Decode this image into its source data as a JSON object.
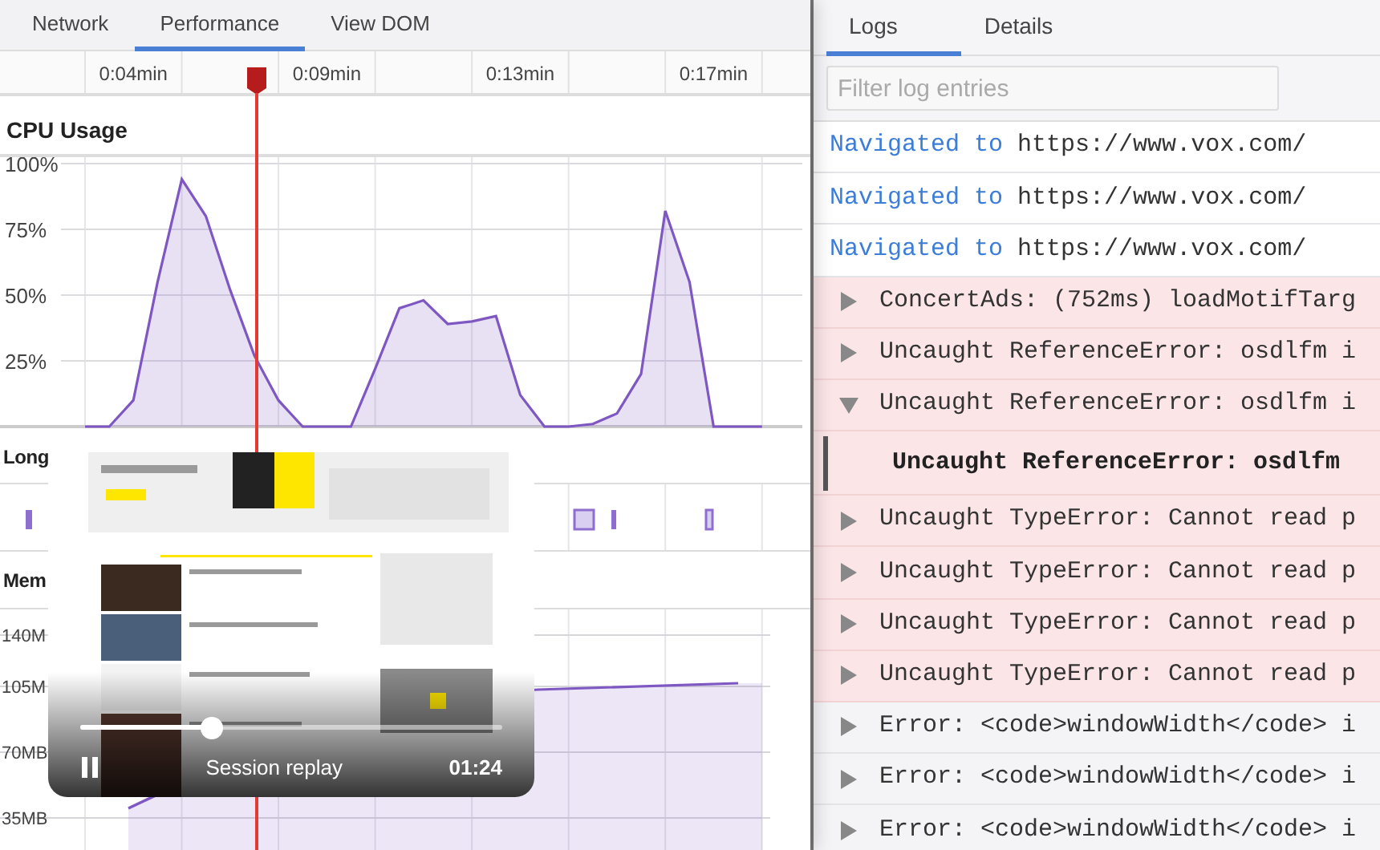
{
  "left_tabs": [
    {
      "label": "Network",
      "selected": false
    },
    {
      "label": "Performance",
      "selected": true
    },
    {
      "label": "View DOM",
      "selected": false
    }
  ],
  "cpu": {
    "title": "CPU Usage",
    "chart_data": {
      "type": "area",
      "categories": [
        null,
        null,
        "0:04min",
        null,
        null,
        null,
        null,
        null,
        null,
        null,
        "0:09min",
        null,
        null,
        null,
        null,
        null,
        null,
        null,
        "0:13min",
        null,
        null,
        null,
        null,
        null,
        null,
        null,
        "0:17min",
        null,
        null
      ],
      "series": [
        {
          "color": "#7e57c2",
          "values": [
            0,
            0,
            10,
            55,
            94,
            80,
            52,
            27,
            10,
            0,
            0,
            0,
            22,
            45,
            48,
            39,
            40,
            42,
            12,
            0,
            0,
            1,
            5,
            20,
            82,
            55,
            0,
            0,
            0
          ]
        }
      ],
      "ylim": [
        0,
        100
      ],
      "grid": true,
      "yticks": [
        {
          "value": 25,
          "label": "25%"
        },
        {
          "value": 50,
          "label": "50%"
        },
        {
          "value": 75,
          "label": "75%"
        },
        {
          "value": 100,
          "label": "100%"
        }
      ]
    }
  },
  "long_tasks": {
    "title": "Long"
  },
  "memory": {
    "title": "Mem",
    "axis_labels": [
      "140M",
      "105M",
      "70MB",
      "35MB"
    ]
  },
  "replay": {
    "title": "Session replay",
    "time": "01:24",
    "level": 0.31,
    "playing": true
  },
  "log_tabs": [
    {
      "label": "Logs",
      "selected": true
    },
    {
      "label": "Details",
      "selected": false
    }
  ],
  "filter": {
    "placeholder": "Filter log entries"
  },
  "logs": [
    {
      "kind": "navigation",
      "action": "Navigated to",
      "url": "https://www.vox.com/"
    },
    {
      "kind": "navigation",
      "action": "Navigated to",
      "url": "https://www.vox.com/"
    },
    {
      "kind": "navigation",
      "action": "Navigated to",
      "url": "https://www.vox.com/"
    },
    {
      "kind": "error",
      "expanded": false,
      "text": "ConcertAds: (752ms) loadMotifTarg"
    },
    {
      "kind": "error",
      "expanded": false,
      "text": "Uncaught ReferenceError: osdlfm i"
    },
    {
      "kind": "error",
      "expanded": true,
      "text": "Uncaught ReferenceError: osdlfm i",
      "children": [
        {
          "text": "Uncaught ReferenceError: osdlfm"
        }
      ]
    },
    {
      "kind": "error",
      "expanded": false,
      "text": "Uncaught TypeError: Cannot read p"
    },
    {
      "kind": "error",
      "expanded": false,
      "text": "Uncaught TypeError: Cannot read p"
    },
    {
      "kind": "error",
      "expanded": false,
      "text": "Uncaught TypeError: Cannot read p"
    },
    {
      "kind": "error",
      "expanded": false,
      "text": "Uncaught TypeError: Cannot read p"
    },
    {
      "kind": "log",
      "expanded": false,
      "text": "Error: <code>windowWidth</code> i"
    },
    {
      "kind": "log",
      "expanded": false,
      "text": "Error: <code>windowWidth</code> i"
    },
    {
      "kind": "log",
      "expanded": false,
      "text": "Error: <code>windowWidth</code> i"
    }
  ]
}
